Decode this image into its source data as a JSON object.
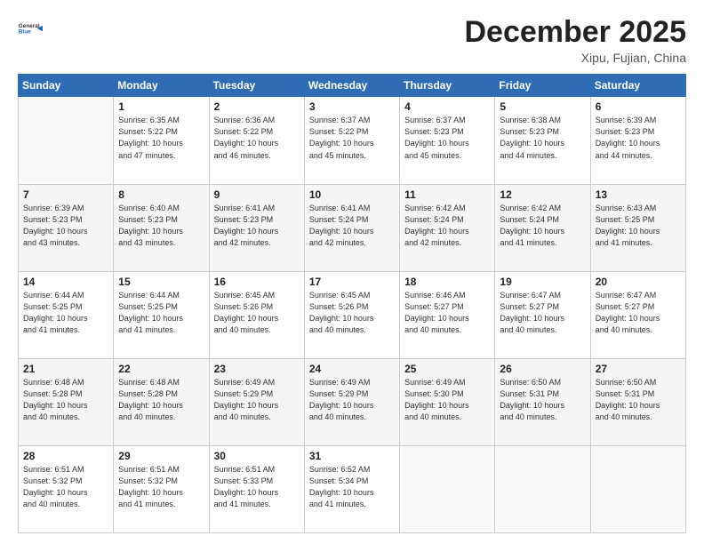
{
  "header": {
    "logo_line1": "General",
    "logo_line2": "Blue",
    "title": "December 2025",
    "location": "Xipu, Fujian, China"
  },
  "weekdays": [
    "Sunday",
    "Monday",
    "Tuesday",
    "Wednesday",
    "Thursday",
    "Friday",
    "Saturday"
  ],
  "weeks": [
    [
      {
        "day": "",
        "info": ""
      },
      {
        "day": "1",
        "info": "Sunrise: 6:35 AM\nSunset: 5:22 PM\nDaylight: 10 hours\nand 47 minutes."
      },
      {
        "day": "2",
        "info": "Sunrise: 6:36 AM\nSunset: 5:22 PM\nDaylight: 10 hours\nand 46 minutes."
      },
      {
        "day": "3",
        "info": "Sunrise: 6:37 AM\nSunset: 5:22 PM\nDaylight: 10 hours\nand 45 minutes."
      },
      {
        "day": "4",
        "info": "Sunrise: 6:37 AM\nSunset: 5:23 PM\nDaylight: 10 hours\nand 45 minutes."
      },
      {
        "day": "5",
        "info": "Sunrise: 6:38 AM\nSunset: 5:23 PM\nDaylight: 10 hours\nand 44 minutes."
      },
      {
        "day": "6",
        "info": "Sunrise: 6:39 AM\nSunset: 5:23 PM\nDaylight: 10 hours\nand 44 minutes."
      }
    ],
    [
      {
        "day": "7",
        "info": "Sunrise: 6:39 AM\nSunset: 5:23 PM\nDaylight: 10 hours\nand 43 minutes."
      },
      {
        "day": "8",
        "info": "Sunrise: 6:40 AM\nSunset: 5:23 PM\nDaylight: 10 hours\nand 43 minutes."
      },
      {
        "day": "9",
        "info": "Sunrise: 6:41 AM\nSunset: 5:23 PM\nDaylight: 10 hours\nand 42 minutes."
      },
      {
        "day": "10",
        "info": "Sunrise: 6:41 AM\nSunset: 5:24 PM\nDaylight: 10 hours\nand 42 minutes."
      },
      {
        "day": "11",
        "info": "Sunrise: 6:42 AM\nSunset: 5:24 PM\nDaylight: 10 hours\nand 42 minutes."
      },
      {
        "day": "12",
        "info": "Sunrise: 6:42 AM\nSunset: 5:24 PM\nDaylight: 10 hours\nand 41 minutes."
      },
      {
        "day": "13",
        "info": "Sunrise: 6:43 AM\nSunset: 5:25 PM\nDaylight: 10 hours\nand 41 minutes."
      }
    ],
    [
      {
        "day": "14",
        "info": "Sunrise: 6:44 AM\nSunset: 5:25 PM\nDaylight: 10 hours\nand 41 minutes."
      },
      {
        "day": "15",
        "info": "Sunrise: 6:44 AM\nSunset: 5:25 PM\nDaylight: 10 hours\nand 41 minutes."
      },
      {
        "day": "16",
        "info": "Sunrise: 6:45 AM\nSunset: 5:26 PM\nDaylight: 10 hours\nand 40 minutes."
      },
      {
        "day": "17",
        "info": "Sunrise: 6:45 AM\nSunset: 5:26 PM\nDaylight: 10 hours\nand 40 minutes."
      },
      {
        "day": "18",
        "info": "Sunrise: 6:46 AM\nSunset: 5:27 PM\nDaylight: 10 hours\nand 40 minutes."
      },
      {
        "day": "19",
        "info": "Sunrise: 6:47 AM\nSunset: 5:27 PM\nDaylight: 10 hours\nand 40 minutes."
      },
      {
        "day": "20",
        "info": "Sunrise: 6:47 AM\nSunset: 5:27 PM\nDaylight: 10 hours\nand 40 minutes."
      }
    ],
    [
      {
        "day": "21",
        "info": "Sunrise: 6:48 AM\nSunset: 5:28 PM\nDaylight: 10 hours\nand 40 minutes."
      },
      {
        "day": "22",
        "info": "Sunrise: 6:48 AM\nSunset: 5:28 PM\nDaylight: 10 hours\nand 40 minutes."
      },
      {
        "day": "23",
        "info": "Sunrise: 6:49 AM\nSunset: 5:29 PM\nDaylight: 10 hours\nand 40 minutes."
      },
      {
        "day": "24",
        "info": "Sunrise: 6:49 AM\nSunset: 5:29 PM\nDaylight: 10 hours\nand 40 minutes."
      },
      {
        "day": "25",
        "info": "Sunrise: 6:49 AM\nSunset: 5:30 PM\nDaylight: 10 hours\nand 40 minutes."
      },
      {
        "day": "26",
        "info": "Sunrise: 6:50 AM\nSunset: 5:31 PM\nDaylight: 10 hours\nand 40 minutes."
      },
      {
        "day": "27",
        "info": "Sunrise: 6:50 AM\nSunset: 5:31 PM\nDaylight: 10 hours\nand 40 minutes."
      }
    ],
    [
      {
        "day": "28",
        "info": "Sunrise: 6:51 AM\nSunset: 5:32 PM\nDaylight: 10 hours\nand 40 minutes."
      },
      {
        "day": "29",
        "info": "Sunrise: 6:51 AM\nSunset: 5:32 PM\nDaylight: 10 hours\nand 41 minutes."
      },
      {
        "day": "30",
        "info": "Sunrise: 6:51 AM\nSunset: 5:33 PM\nDaylight: 10 hours\nand 41 minutes."
      },
      {
        "day": "31",
        "info": "Sunrise: 6:52 AM\nSunset: 5:34 PM\nDaylight: 10 hours\nand 41 minutes."
      },
      {
        "day": "",
        "info": ""
      },
      {
        "day": "",
        "info": ""
      },
      {
        "day": "",
        "info": ""
      }
    ]
  ],
  "row_shades": [
    false,
    true,
    false,
    true,
    false
  ]
}
